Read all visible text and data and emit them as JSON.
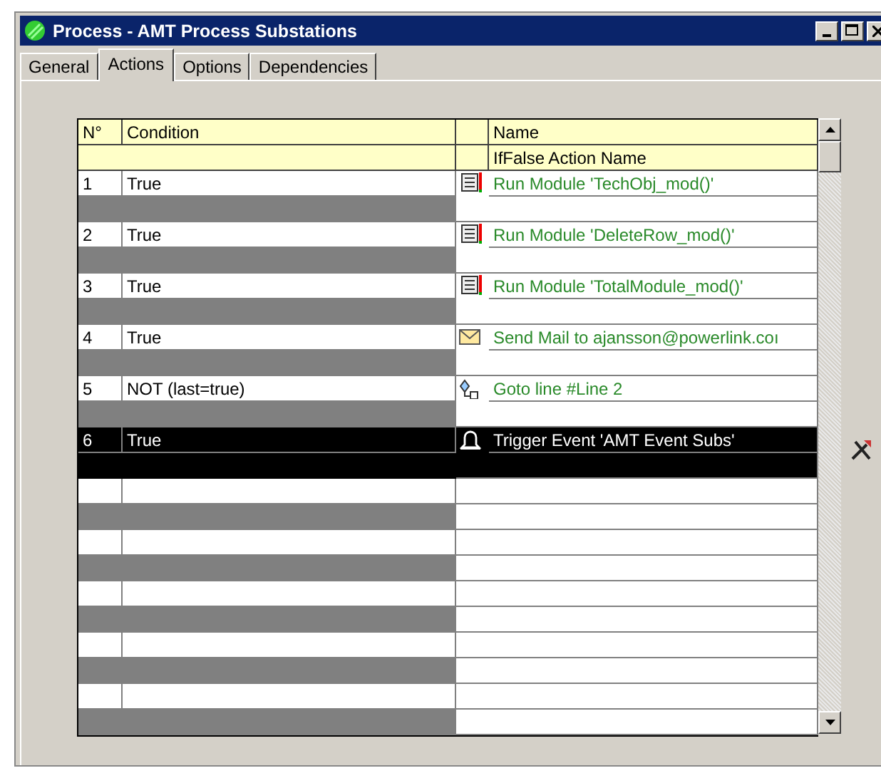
{
  "window": {
    "title": "Process - AMT Process Substations"
  },
  "tabs": [
    {
      "label": "General",
      "selected": false
    },
    {
      "label": "Actions",
      "selected": true
    },
    {
      "label": "Options",
      "selected": false
    },
    {
      "label": "Dependencies",
      "selected": false
    }
  ],
  "table": {
    "columns": [
      "N°",
      "Condition",
      "Name"
    ],
    "sub_column": "IfFalse Action Name",
    "rows": [
      {
        "number": "1",
        "condition": "True",
        "action": {
          "kind": "module",
          "name": "Run Module 'TechObj_mod()'"
        },
        "selected": false
      },
      {
        "number": "2",
        "condition": "True",
        "action": {
          "kind": "module",
          "name": "Run Module 'DeleteRow_mod()'"
        },
        "selected": false
      },
      {
        "number": "3",
        "condition": "True",
        "action": {
          "kind": "module",
          "name": "Run Module 'TotalModule_mod()'"
        },
        "selected": false
      },
      {
        "number": "4",
        "condition": "True",
        "action": {
          "kind": "mail",
          "name": "Send Mail to ajansson@powerlink.coı"
        },
        "selected": false
      },
      {
        "number": "5",
        "condition": "NOT (last=true)",
        "action": {
          "kind": "goto",
          "name": "Goto line #Line 2"
        },
        "selected": false
      },
      {
        "number": "6",
        "condition": "True",
        "action": {
          "kind": "event",
          "name": "Trigger Event 'AMT Event Subs'"
        },
        "selected": true
      }
    ]
  }
}
